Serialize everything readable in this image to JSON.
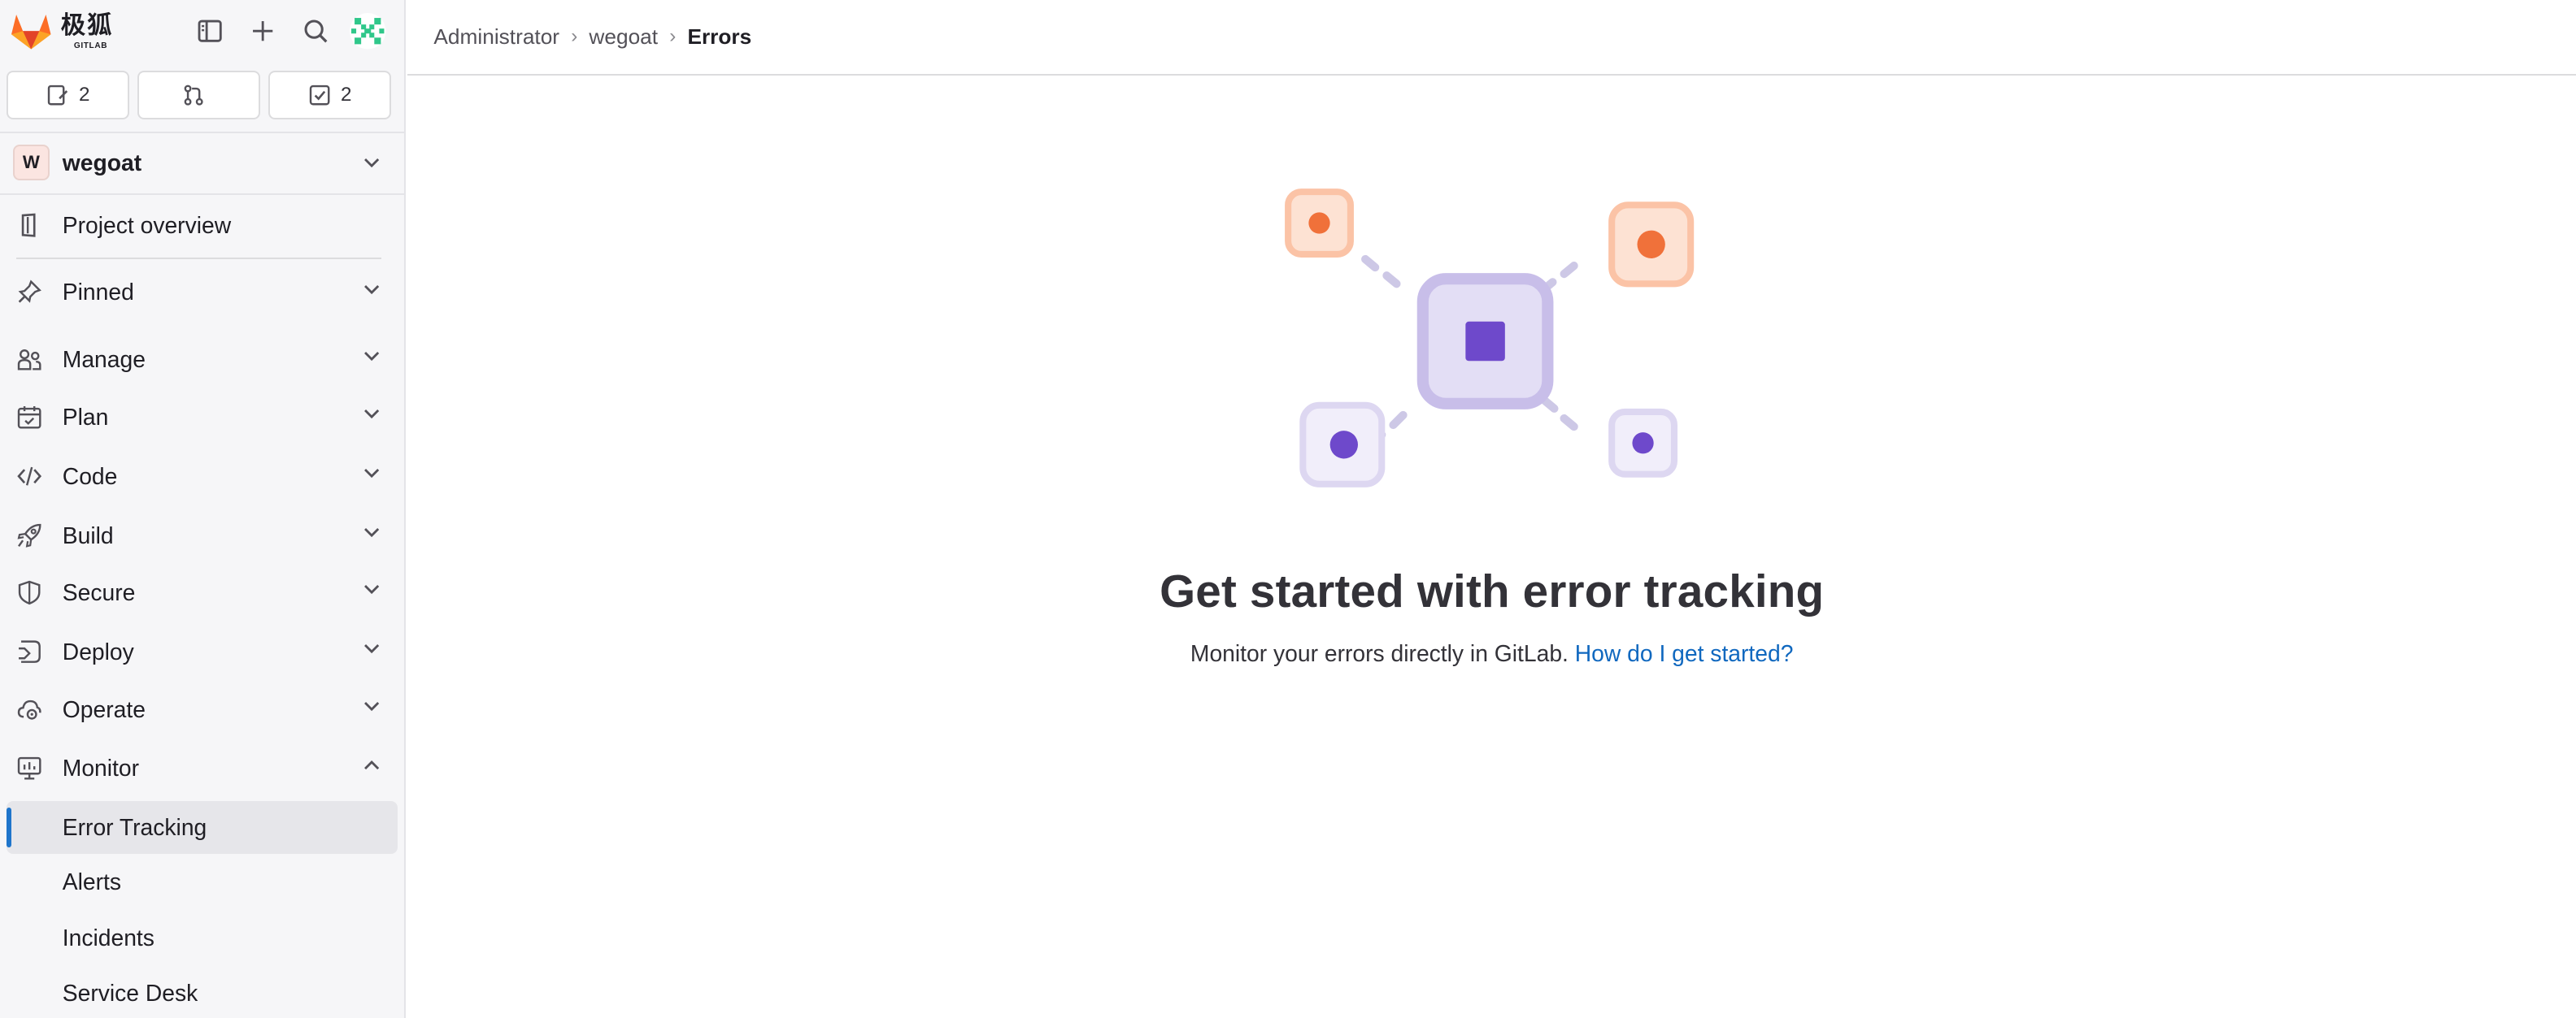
{
  "brand": {
    "name": "极狐",
    "sub": "GITLAB"
  },
  "topbar": {
    "icons": [
      "sidebar-toggle-icon",
      "plus-icon",
      "search-icon",
      "user-avatar-icon"
    ]
  },
  "counts": [
    {
      "icon": "issues-icon",
      "value": "2"
    },
    {
      "icon": "merge-request-icon",
      "value": ""
    },
    {
      "icon": "todo-icon",
      "value": "2"
    }
  ],
  "project": {
    "initial": "W",
    "name": "wegoat"
  },
  "nav": {
    "overview": "Project overview",
    "pinned": "Pinned",
    "manage": "Manage",
    "plan": "Plan",
    "code": "Code",
    "build": "Build",
    "secure": "Secure",
    "deploy": "Deploy",
    "operate": "Operate",
    "monitor": "Monitor",
    "monitor_items": [
      "Error Tracking",
      "Alerts",
      "Incidents",
      "Service Desk"
    ]
  },
  "breadcrumb": [
    "Administrator",
    "wegoat",
    "Errors"
  ],
  "empty_state": {
    "title": "Get started with error tracking",
    "description": "Monitor your errors directly in GitLab.",
    "link": "How do I get started?"
  },
  "colors": {
    "accent": "#1f75cb",
    "link": "#1068bf",
    "orange": "#f0713a",
    "purple": "#6e49cb"
  }
}
